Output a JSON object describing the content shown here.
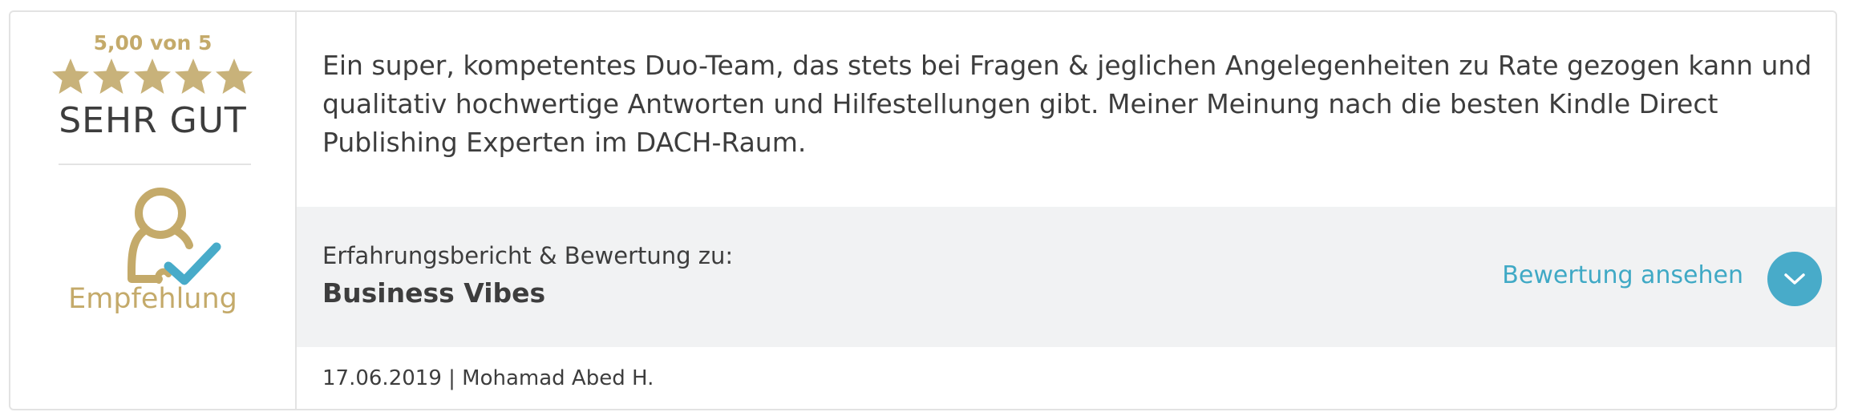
{
  "rating": {
    "score_text": "5,00 von 5",
    "score": 5.0,
    "max": 5,
    "stars_filled": 5,
    "verdict": "SEHR GUT",
    "star_color": "#c8b27a"
  },
  "recommendation": {
    "icon": "person-check-icon",
    "label": "Empfehlung",
    "accent": "#c4aa6a",
    "check_color": "#48abc9"
  },
  "review": {
    "text": "Ein super, kompetentes Duo-Team, das stets bei Fragen & jeglichen Angelegenheiten zu Rate gezogen kann und qualitativ hochwertige Antworten und Hilfestellungen gibt. Meiner Meinung nach die besten Kindle Direct Publishing Experten im DACH-Raum."
  },
  "report": {
    "label": "Erfahrungsbericht & Bewertung zu:",
    "product": "Business Vibes",
    "view_link": "Bewertung ansehen",
    "toggle_icon": "chevron-down-icon",
    "link_color": "#3fa9c5",
    "band_color": "#f1f2f3"
  },
  "meta": {
    "line": "17.06.2019 | Mohamad Abed H."
  }
}
